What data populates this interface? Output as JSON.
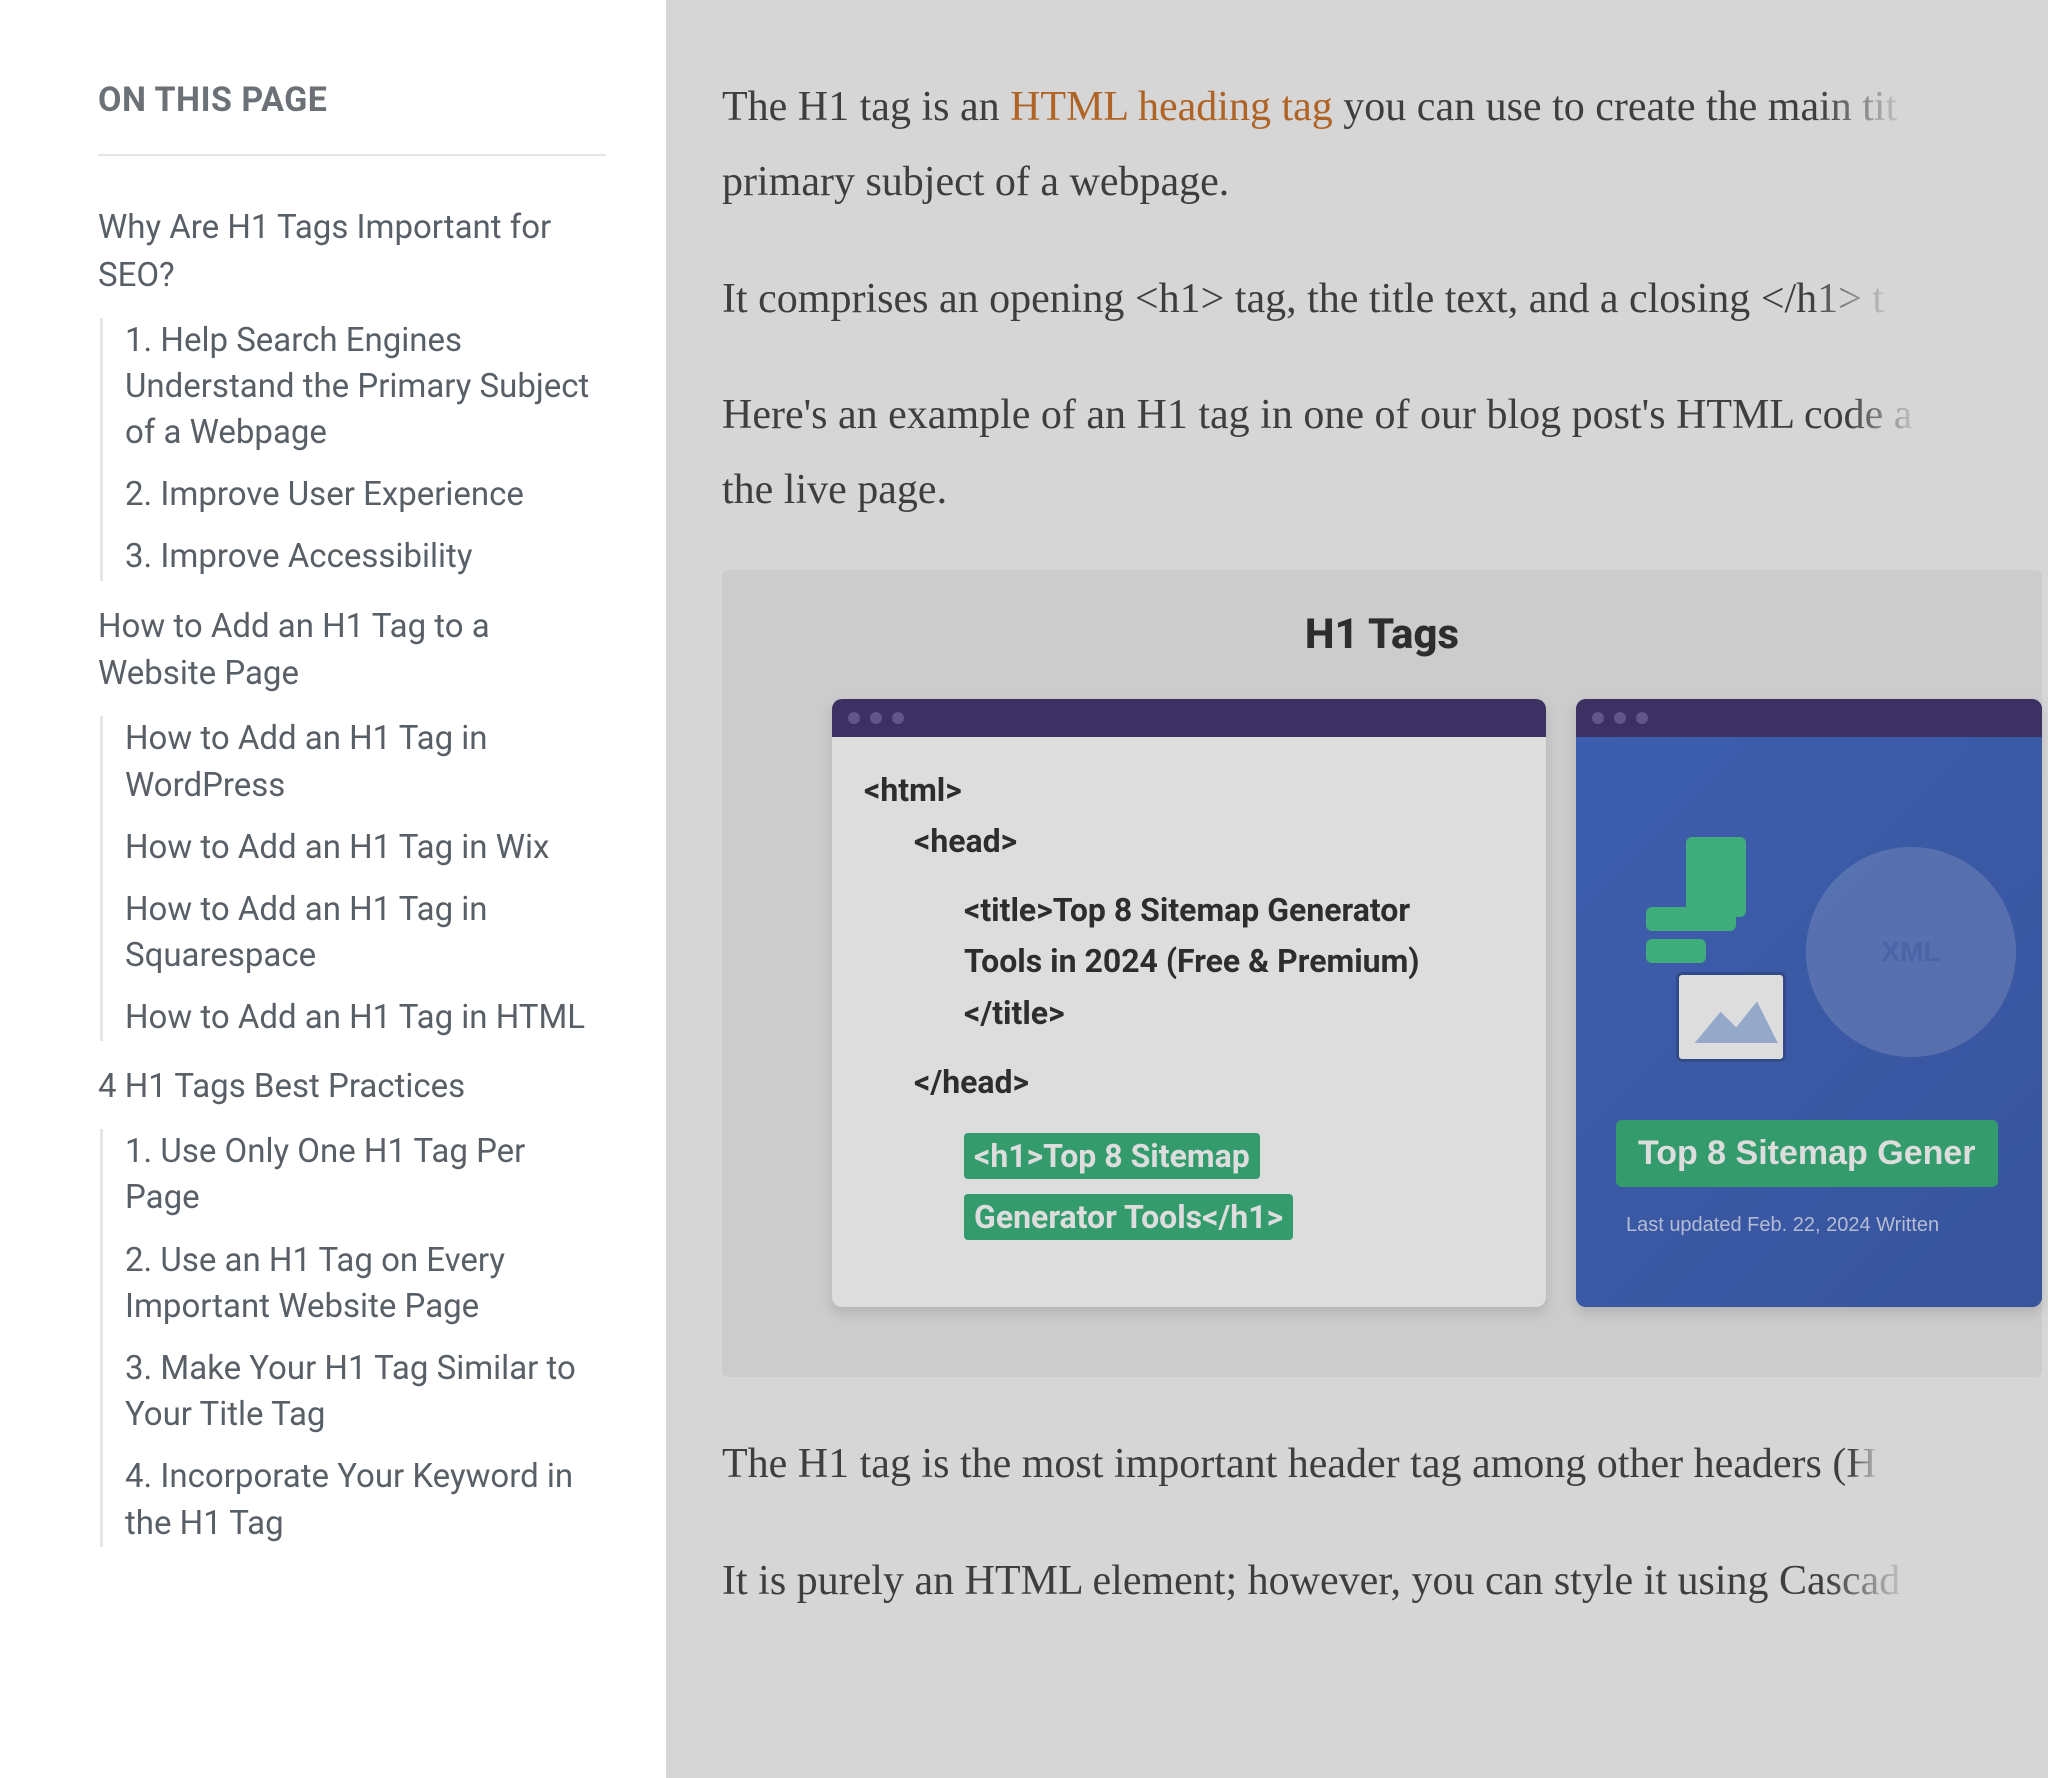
{
  "toc": {
    "title": "ON THIS PAGE",
    "sections": [
      {
        "label": "Why Are H1 Tags Important for SEO?",
        "items": [
          "1. Help Search Engines Understand the Primary Subject of a Webpage",
          "2. Improve User Experience",
          "3. Improve Accessibility"
        ]
      },
      {
        "label": "How to Add an H1 Tag to a Website Page",
        "items": [
          "How to Add an H1 Tag in WordPress",
          "How to Add an H1 Tag in Wix",
          "How to Add an H1 Tag in Squarespace",
          "How to Add an H1 Tag in HTML"
        ]
      },
      {
        "label": "4 H1 Tags Best Practices",
        "items": [
          "1. Use Only One H1 Tag Per Page",
          "2. Use an H1 Tag on Every Important Website Page",
          "3. Make Your H1 Tag Similar to Your Title Tag",
          "4. Incorporate Your Keyword in the H1 Tag"
        ]
      }
    ]
  },
  "article": {
    "p1_a": "The H1 tag is an ",
    "p1_link": "HTML heading tag",
    "p1_b": " you can use to create the ",
    "p1_fade": "main tit",
    "p1_c": "primary subject of a webpage.",
    "p2_a": "It comprises an opening <h1> tag, the title text, and a closing ",
    "p2_fade": "</h1> t",
    "p3_a": "Here's an example of an H1 tag in one of our blog post's HTML ",
    "p3_fade": "code a",
    "p3_b": "the live page.",
    "p4_a": "The H1 tag is the most important header tag among other headers ",
    "p4_fade": "(H",
    "p5_a": "It is purely an HTML element; however, you can style it using ",
    "p5_fade": "Cascad"
  },
  "figure": {
    "title": "H1 Tags",
    "code": {
      "html_open": "<html>",
      "head_open": "<head>",
      "title_line1": "<title>Top 8 Sitemap Generator",
      "title_line2": "Tools in 2024 (Free & Premium)",
      "title_close": "</title>",
      "head_close": "</head>",
      "h1_text": "<h1>Top 8 Sitemap Generator Tools</h1>"
    },
    "preview": {
      "xml_label": "XML",
      "headline": "Top 8 Sitemap Gener",
      "meta": "Last updated Feb. 22, 2024          Written"
    }
  }
}
